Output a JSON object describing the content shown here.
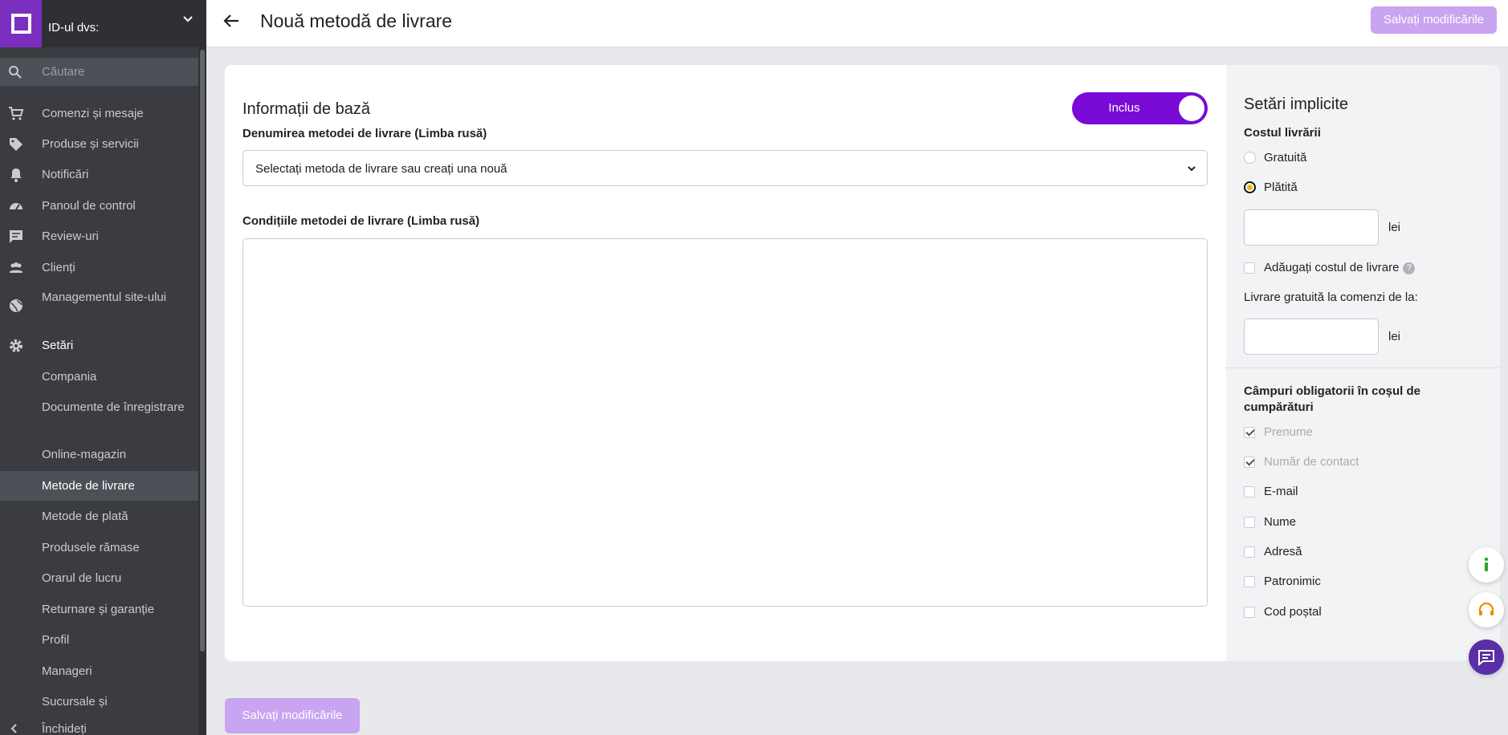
{
  "sidebar": {
    "store_id_label": "ID-ul dvs:",
    "search_placeholder": "Căutare",
    "items": [
      {
        "label": "Comenzi și mesaje",
        "icon": "cart-icon"
      },
      {
        "label": "Produse și servicii",
        "icon": "tag-icon"
      },
      {
        "label": "Notificări",
        "icon": "bell-icon"
      },
      {
        "label": "Panoul de control",
        "icon": "gauge-icon"
      },
      {
        "label": "Review-uri",
        "icon": "comment-icon"
      },
      {
        "label": "Clienți",
        "icon": "people-icon"
      },
      {
        "label": "Managementul site-ului",
        "icon": "globe-icon"
      },
      {
        "label": "Setări",
        "icon": "gear-icon"
      }
    ],
    "subitems": [
      "Compania",
      "Documente de înregistrare",
      "Online-magazin",
      "Metode de livrare",
      "Metode de plată",
      "Produsele rămase",
      "Orarul de lucru",
      "Returnare și garanție",
      "Profil",
      "Manageri",
      "Sucursale și"
    ],
    "close_label": "Închideți"
  },
  "header": {
    "title": "Nouă metodă de livrare",
    "save_label": "Salvați modificările"
  },
  "main": {
    "section_title": "Informații de bază",
    "toggle_label": "Inclus",
    "name_label": "Denumirea metodei de livrare (Limba rusă)",
    "name_select_value": "Selectați metoda de livrare sau creați una nouă",
    "conditions_label": "Condițiile metodei de livrare (Limba rusă)",
    "conditions_value": ""
  },
  "right_panel": {
    "title": "Setări implicite",
    "cost_label": "Costul livrării",
    "radio_free": "Gratuită",
    "radio_paid": "Plătită",
    "currency": "lei",
    "add_cost_label": "Adăugați costul de livrare",
    "free_delivery_label": "Livrare gratuită la comenzi de la:",
    "required_fields_title": "Câmpuri obligatorii în coșul de cumpărături",
    "fields": [
      {
        "label": "Prenume",
        "checked": true,
        "disabled": true
      },
      {
        "label": "Număr de contact",
        "checked": true,
        "disabled": true
      },
      {
        "label": "E-mail",
        "checked": false,
        "disabled": false
      },
      {
        "label": "Nume",
        "checked": false,
        "disabled": false
      },
      {
        "label": "Adresă",
        "checked": false,
        "disabled": false
      },
      {
        "label": "Patronimic",
        "checked": false,
        "disabled": false
      },
      {
        "label": "Cod poștal",
        "checked": false,
        "disabled": false
      }
    ]
  },
  "footer": {
    "save_label": "Salvați modificările"
  },
  "colors": {
    "brand_purple": "#7a0ad6",
    "save_disabled": "#c9a4f0",
    "sidebar_bg": "#3a3c42"
  }
}
